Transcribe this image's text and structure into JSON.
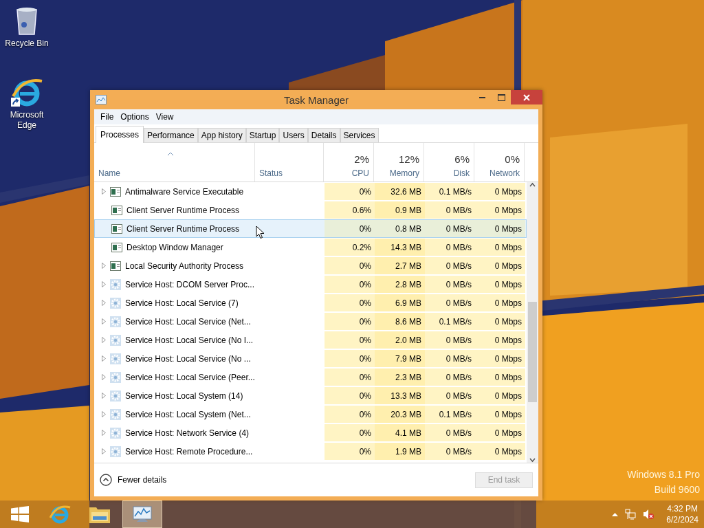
{
  "desktop_icons": [
    {
      "kind": "recycle",
      "label": "Recycle Bin"
    },
    {
      "kind": "browser",
      "label": "Microsoft Edge",
      "shortcut": true
    }
  ],
  "os_edition": [
    "Windows 8.1 Pro",
    "Build 9600"
  ],
  "window": {
    "title": "Task Manager",
    "menu": [
      "File",
      "Options",
      "View"
    ],
    "tabs": [
      {
        "label": "Processes",
        "selected": true
      },
      {
        "label": "Performance",
        "selected": false
      },
      {
        "label": "App history",
        "selected": false
      },
      {
        "label": "Startup",
        "selected": false
      },
      {
        "label": "Users",
        "selected": false
      },
      {
        "label": "Details",
        "selected": false
      },
      {
        "label": "Services",
        "selected": false
      }
    ],
    "columns": [
      {
        "kind": "name",
        "label": "Name",
        "sorted": true
      },
      {
        "kind": "status",
        "label": "Status",
        "sorted": false
      },
      {
        "kind": "metric",
        "percent": "2%",
        "label": "CPU",
        "sorted": false
      },
      {
        "kind": "metric",
        "percent": "12%",
        "label": "Memory",
        "sorted": false
      },
      {
        "kind": "metric",
        "percent": "6%",
        "label": "Disk",
        "sorted": false
      },
      {
        "kind": "metric",
        "percent": "0%",
        "label": "Network",
        "sorted": false
      }
    ],
    "rows": [
      {
        "name": "Antimalware Service Executable",
        "kind": "app",
        "expandable": true,
        "selected": false,
        "cpu": "0%",
        "memory": "32.6 MB",
        "disk": "0.1 MB/s",
        "network": "0 Mbps"
      },
      {
        "name": "Client Server Runtime Process",
        "kind": "app",
        "expandable": false,
        "selected": false,
        "cpu": "0.6%",
        "memory": "0.9 MB",
        "disk": "0 MB/s",
        "network": "0 Mbps"
      },
      {
        "name": "Client Server Runtime Process",
        "kind": "app",
        "expandable": false,
        "selected": true,
        "cpu": "0%",
        "memory": "0.8 MB",
        "disk": "0 MB/s",
        "network": "0 Mbps"
      },
      {
        "name": "Desktop Window Manager",
        "kind": "app",
        "expandable": false,
        "selected": false,
        "cpu": "0.2%",
        "memory": "14.3 MB",
        "disk": "0 MB/s",
        "network": "0 Mbps"
      },
      {
        "name": "Local Security Authority Process",
        "kind": "app",
        "expandable": true,
        "selected": false,
        "cpu": "0%",
        "memory": "2.7 MB",
        "disk": "0 MB/s",
        "network": "0 Mbps"
      },
      {
        "name": "Service Host: DCOM Server Proc...",
        "kind": "service",
        "expandable": true,
        "selected": false,
        "cpu": "0%",
        "memory": "2.8 MB",
        "disk": "0 MB/s",
        "network": "0 Mbps"
      },
      {
        "name": "Service Host: Local Service (7)",
        "kind": "service",
        "expandable": true,
        "selected": false,
        "cpu": "0%",
        "memory": "6.9 MB",
        "disk": "0 MB/s",
        "network": "0 Mbps"
      },
      {
        "name": "Service Host: Local Service (Net...",
        "kind": "service",
        "expandable": true,
        "selected": false,
        "cpu": "0%",
        "memory": "8.6 MB",
        "disk": "0.1 MB/s",
        "network": "0 Mbps"
      },
      {
        "name": "Service Host: Local Service (No I...",
        "kind": "service",
        "expandable": true,
        "selected": false,
        "cpu": "0%",
        "memory": "2.0 MB",
        "disk": "0 MB/s",
        "network": "0 Mbps"
      },
      {
        "name": "Service Host: Local Service (No ...",
        "kind": "service",
        "expandable": true,
        "selected": false,
        "cpu": "0%",
        "memory": "7.9 MB",
        "disk": "0 MB/s",
        "network": "0 Mbps"
      },
      {
        "name": "Service Host: Local Service (Peer...",
        "kind": "service",
        "expandable": true,
        "selected": false,
        "cpu": "0%",
        "memory": "2.3 MB",
        "disk": "0 MB/s",
        "network": "0 Mbps"
      },
      {
        "name": "Service Host: Local System (14)",
        "kind": "service",
        "expandable": true,
        "selected": false,
        "cpu": "0%",
        "memory": "13.3 MB",
        "disk": "0 MB/s",
        "network": "0 Mbps"
      },
      {
        "name": "Service Host: Local System (Net...",
        "kind": "service",
        "expandable": true,
        "selected": false,
        "cpu": "0%",
        "memory": "20.3 MB",
        "disk": "0.1 MB/s",
        "network": "0 Mbps"
      },
      {
        "name": "Service Host: Network Service (4)",
        "kind": "service",
        "expandable": true,
        "selected": false,
        "cpu": "0%",
        "memory": "4.1 MB",
        "disk": "0 MB/s",
        "network": "0 Mbps"
      },
      {
        "name": "Service Host: Remote Procedure...",
        "kind": "service",
        "expandable": true,
        "selected": false,
        "cpu": "0%",
        "memory": "1.9 MB",
        "disk": "0 MB/s",
        "network": "0 Mbps"
      }
    ],
    "footer": {
      "toggle": "Fewer details",
      "end_task": {
        "label": "End task",
        "disabled": true
      }
    }
  },
  "taskbar": {
    "buttons": [
      {
        "kind": "start",
        "active": false
      },
      {
        "kind": "browser",
        "active": false
      },
      {
        "kind": "folder",
        "active": false
      },
      {
        "kind": "taskmgr",
        "active": true
      }
    ],
    "tray": {
      "time": "4:32 PM",
      "date": "6/2/2024"
    }
  }
}
